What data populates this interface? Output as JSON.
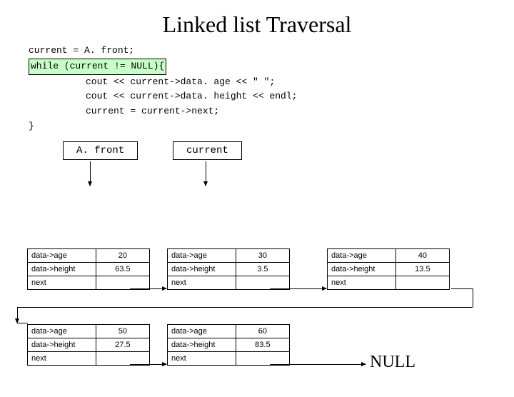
{
  "title": "Linked list Traversal",
  "code": {
    "l1": "current = A. front;",
    "l2": "while (current != NULL){",
    "l3": "cout << current->data. age << \"   \";",
    "l4": "cout << current->data. height << endl;",
    "l5": "current = current->next;",
    "l6": "}"
  },
  "pointers": {
    "front_label": "A. front",
    "current_label": "current"
  },
  "field_labels": {
    "age": "data->age",
    "height": "data->height",
    "next": "next"
  },
  "nodes": [
    {
      "age": "20",
      "height": "63.5"
    },
    {
      "age": "30",
      "height": "3.5"
    },
    {
      "age": "40",
      "height": "13.5"
    },
    {
      "age": "50",
      "height": "27.5"
    },
    {
      "age": "60",
      "height": "83.5"
    }
  ],
  "null_label": "NULL"
}
